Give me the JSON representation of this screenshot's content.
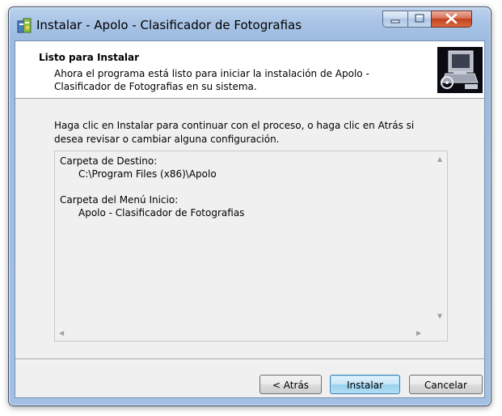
{
  "window": {
    "title": "Instalar - Apolo - Clasificador de Fotografias",
    "controls": [
      "minimize",
      "maximize",
      "close"
    ]
  },
  "header": {
    "title": "Listo para Instalar",
    "description": "Ahora el programa está listo para iniciar la instalación de Apolo - Clasificador de Fotografias en su sistema."
  },
  "body": {
    "instruction": "Haga clic en Instalar para continuar con el proceso, o haga clic en Atrás si desea revisar o cambiar alguna configuración."
  },
  "summary": {
    "dest_label": "Carpeta de Destino:",
    "dest_value": "C:\\Program Files (x86)\\Apolo",
    "menu_label": "Carpeta del Menú Inicio:",
    "menu_value": "Apolo - Clasificador de Fotografias"
  },
  "buttons": {
    "back": "< Atrás",
    "install": "Instalar",
    "cancel": "Cancelar"
  },
  "icons": {
    "app": "installer-app-icon",
    "wizard": "computer-setup-icon"
  },
  "colors": {
    "titlebar": "#a9c4e6",
    "close_button": "#c2411e",
    "default_button_border": "#3c7fb1"
  }
}
